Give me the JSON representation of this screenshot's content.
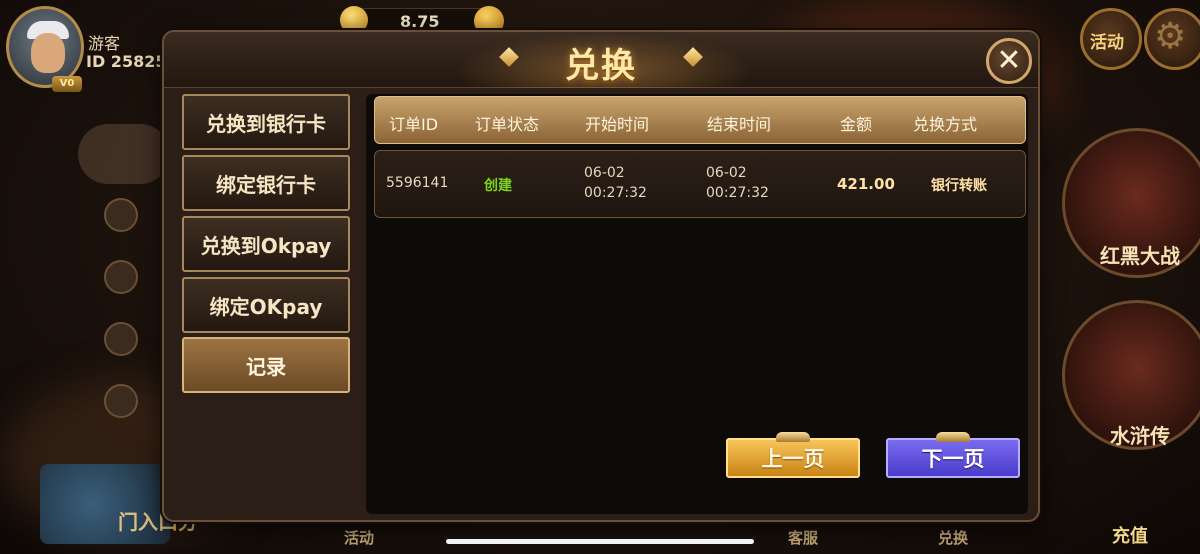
{
  "lobby": {
    "user_name": "游客",
    "user_id": "ID 25825",
    "vip_level": "V0",
    "coin_balance": "8.75",
    "activity_label": "活动",
    "game_cards": [
      "红黑大战",
      "水浒传"
    ],
    "recharge_label": "充值",
    "bottom_nav": [
      "活动",
      "客服",
      "兑换"
    ],
    "promo_text": "门入口分"
  },
  "modal": {
    "title": "兑换",
    "close_icon": "close-icon",
    "nav": [
      {
        "label": "兑换到银行卡",
        "active": false
      },
      {
        "label": "绑定银行卡",
        "active": false
      },
      {
        "label": "兑换到Okpay",
        "active": false
      },
      {
        "label": "绑定OKpay",
        "active": false
      },
      {
        "label": "记录",
        "active": true
      }
    ],
    "table": {
      "headers": [
        "订单ID",
        "订单状态",
        "开始时间",
        "结束时间",
        "金额",
        "兑换方式"
      ],
      "rows": [
        {
          "order_id": "5596141",
          "status": "创建",
          "start_date": "06-02",
          "start_time": "00:27:32",
          "end_date": "06-02",
          "end_time": "00:27:32",
          "amount": "421.00",
          "method": "银行转账"
        }
      ]
    },
    "pagination": {
      "prev_label": "上一页",
      "next_label": "下一页"
    }
  },
  "colors": {
    "accent_gold": "#d7b27a",
    "status_green": "#7ed321",
    "next_button": "#5a4cd8",
    "prev_button": "#e6a52e"
  }
}
